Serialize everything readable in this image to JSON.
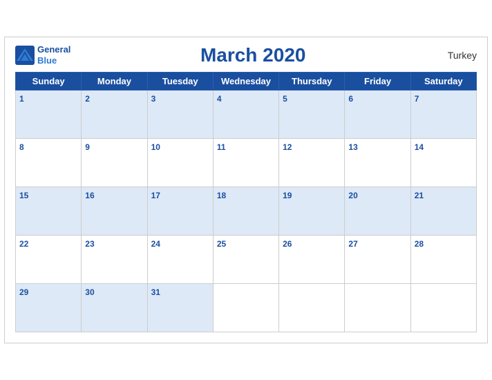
{
  "header": {
    "logo": {
      "general": "General",
      "blue": "Blue",
      "icon_color": "#2e7bd4"
    },
    "title": "March 2020",
    "country": "Turkey"
  },
  "days_of_week": [
    "Sunday",
    "Monday",
    "Tuesday",
    "Wednesday",
    "Thursday",
    "Friday",
    "Saturday"
  ],
  "weeks": [
    [
      1,
      2,
      3,
      4,
      5,
      6,
      7
    ],
    [
      8,
      9,
      10,
      11,
      12,
      13,
      14
    ],
    [
      15,
      16,
      17,
      18,
      19,
      20,
      21
    ],
    [
      22,
      23,
      24,
      25,
      26,
      27,
      28
    ],
    [
      29,
      30,
      31,
      null,
      null,
      null,
      null
    ]
  ],
  "colors": {
    "header_bg": "#1a4fa0",
    "odd_row_bg": "#dde9f7",
    "even_row_bg": "#ffffff",
    "day_number_color": "#1a4fa0",
    "logo_blue": "#2e7bd4"
  }
}
